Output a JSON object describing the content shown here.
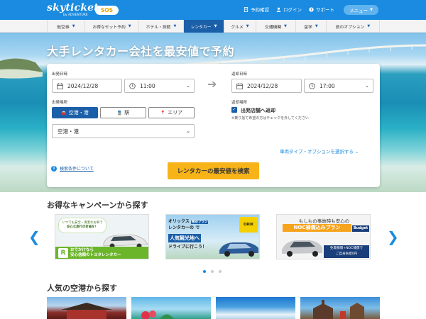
{
  "header": {
    "logo": "skyticket",
    "logo_sub": "by ADVENTURE",
    "badge": "SOS",
    "links": [
      "予約確認",
      "ログイン",
      "サポート"
    ],
    "menu": "メニュー",
    "brand_color": "#1a8be0"
  },
  "nav": {
    "items": [
      "航空券",
      "お得なセット予約",
      "ホテル・旅館",
      "レンタカー",
      "グルメ",
      "交通機関",
      "留学",
      "旅のオプション"
    ],
    "active_index": 3
  },
  "hero": {
    "title": "大手レンタカー会社を最安値で予約"
  },
  "search": {
    "departure_label": "出発日時",
    "departure_date": "2024/12/28",
    "departure_time": "11:00",
    "return_label": "返却日時",
    "return_date": "2024/12/28",
    "return_time": "17:00",
    "departure_place_label": "出発場所",
    "segments": [
      "空港・港",
      "駅",
      "エリア"
    ],
    "segment_active": 0,
    "place_select": "空港・港",
    "return_place_label": "返却場所",
    "same_store_checked": true,
    "same_store_label": "出発店舗へ返却",
    "same_store_note": "※乗り捨て希望の方はチェックを外してください",
    "options_link": "車両タイプ・オプションを選択する",
    "info_link": "検索条件について",
    "search_button": "レンタカーの最安値を検索"
  },
  "campaign": {
    "title": "お得なキャンペーンから探す",
    "banners": [
      {
        "top_text": "いつでも安全・清潔なお車で",
        "top_text2": "安心な旅行の計画を！",
        "bottom_text": "おでかけなら",
        "bottom_text2": "安心信頼のトヨタレンタカー"
      },
      {
        "line1": "オリックス",
        "badge": "格安プラン",
        "line2": "レンタカーの",
        "line3": "で",
        "line4": "人気観光地へ",
        "line5": "ドライブに行こう！",
        "logo": "ORIX"
      },
      {
        "line1": "もしもの事故時も安心の",
        "line2": "NOC補償込みプラン",
        "logo": "Budget",
        "line3": "免責補償+NOC補償で",
        "line4": "ご自身負担0円"
      }
    ],
    "dots": 3,
    "active_dot": 0
  },
  "airports": {
    "title": "人気の空港から探す"
  }
}
